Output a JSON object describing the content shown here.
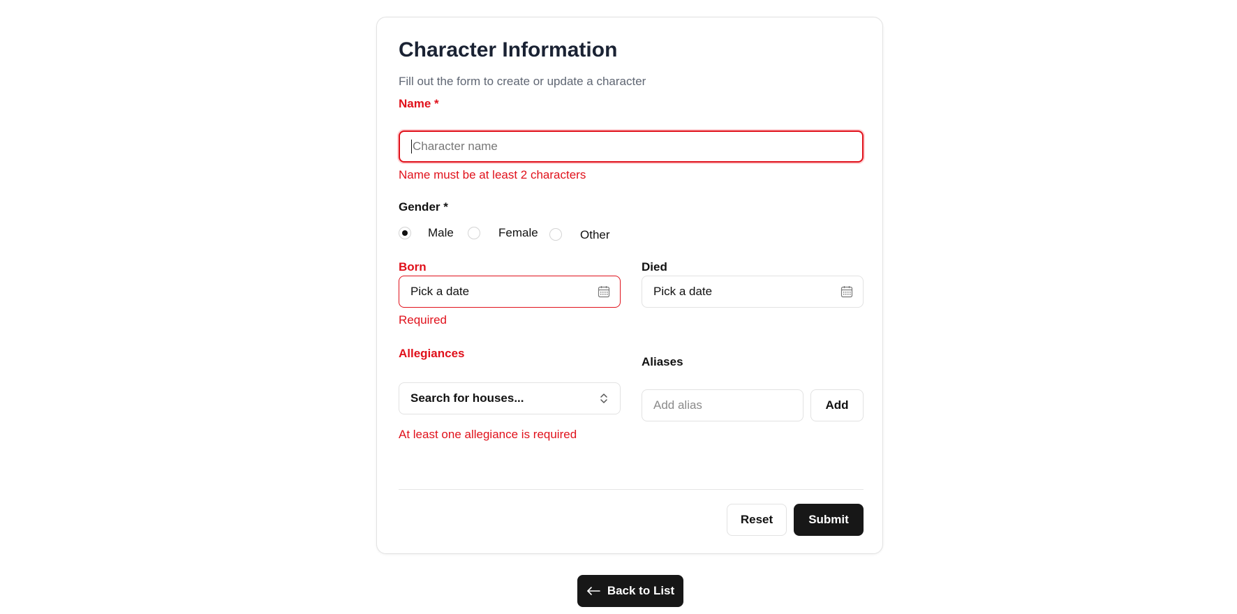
{
  "form": {
    "title": "Character Information",
    "subtitle": "Fill out the form to create or update a character",
    "name": {
      "label": "Name *",
      "placeholder": "Character name",
      "error": "Name must be at least 2 characters"
    },
    "gender": {
      "label": "Gender *",
      "options": [
        {
          "label": "Male",
          "selected": true
        },
        {
          "label": "Female",
          "selected": false
        },
        {
          "label": "Other",
          "selected": false
        }
      ]
    },
    "born": {
      "label": "Born",
      "placeholder": "Pick a date",
      "error": "Required",
      "icon": "calendar-icon"
    },
    "died": {
      "label": "Died",
      "placeholder": "Pick a date",
      "icon": "calendar-icon"
    },
    "allegiances": {
      "label": "Allegiances",
      "placeholder": "Search for houses...",
      "error": "At least one allegiance is required",
      "icon": "chevron-up-down-icon"
    },
    "aliases": {
      "label": "Aliases",
      "placeholder": "Add alias",
      "add_label": "Add"
    },
    "actions": {
      "reset_label": "Reset",
      "submit_label": "Submit"
    }
  },
  "back_label": "Back to List",
  "colors": {
    "error": "#e0111b",
    "primary_button": "#171717",
    "title": "#1a2233",
    "muted": "#5f6673"
  }
}
